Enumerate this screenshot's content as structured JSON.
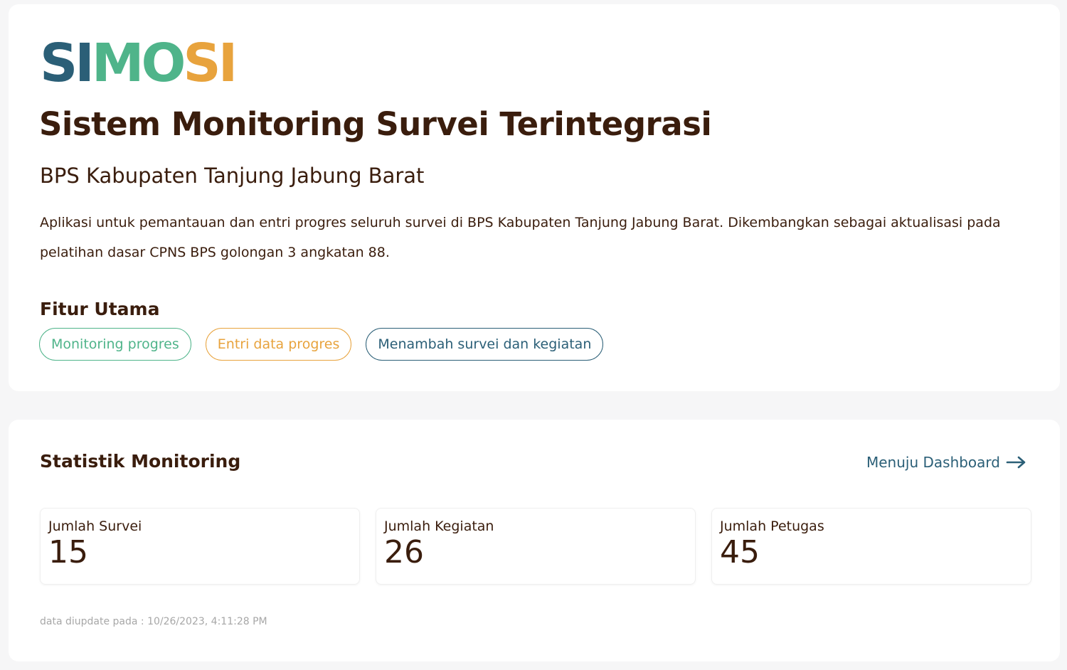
{
  "logo": {
    "letters": [
      "S",
      "I",
      "M",
      "O",
      "S",
      "I"
    ],
    "colors": [
      "#2b5f77",
      "#2b5f77",
      "#4fb48a",
      "#4fb48a",
      "#e8a33d",
      "#e8a33d"
    ]
  },
  "hero": {
    "title": "Sistem Monitoring Survei Terintegrasi",
    "subtitle": "BPS Kabupaten Tanjung Jabung Barat",
    "description": "Aplikasi untuk pemantauan dan entri progres seluruh survei di BPS Kabupaten Tanjung Jabung Barat. Dikembangkan sebagai aktualisasi pada pelatihan dasar CPNS BPS golongan 3 angkatan 88.",
    "features_heading": "Fitur Utama",
    "features": [
      {
        "label": "Monitoring progres",
        "color": "#4fb48a"
      },
      {
        "label": "Entri data progres",
        "color": "#e8a33d"
      },
      {
        "label": "Menambah survei dan kegiatan",
        "color": "#2b5f77"
      }
    ]
  },
  "stats": {
    "heading": "Statistik Monitoring",
    "dashboard_link": "Menuju Dashboard",
    "dashboard_icon": "arrow-right-icon",
    "link_color": "#2b5f77",
    "items": [
      {
        "label": "Jumlah Survei",
        "value": "15"
      },
      {
        "label": "Jumlah Kegiatan",
        "value": "26"
      },
      {
        "label": "Jumlah Petugas",
        "value": "45"
      }
    ],
    "updated": "data diupdate pada : 10/26/2023, 4:11:28 PM"
  }
}
